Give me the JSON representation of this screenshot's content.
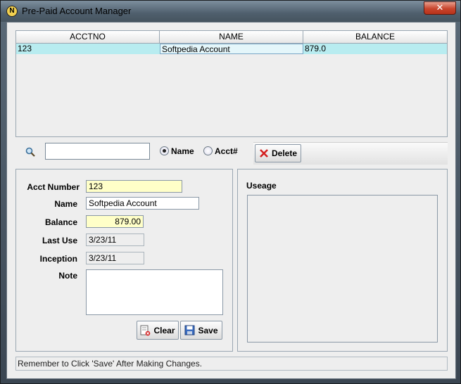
{
  "window": {
    "title": "Pre-Paid Account Manager",
    "app_icon_letter": "N",
    "close_glyph": "✕"
  },
  "table": {
    "columns": [
      "ACCTNO",
      "NAME",
      "BALANCE"
    ],
    "rows": [
      [
        "123",
        "Softpedia Account",
        "879.0"
      ]
    ]
  },
  "search": {
    "value": "",
    "radio_name_label": "Name",
    "radio_acct_label": "Acct#",
    "selected": "Name",
    "delete_label": "Delete"
  },
  "form": {
    "acct_number_label": "Acct Number",
    "acct_number_value": "123",
    "name_label": "Name",
    "name_value": "Softpedia Account",
    "balance_label": "Balance",
    "balance_value": "879.00",
    "last_use_label": "Last Use",
    "last_use_value": "3/23/11",
    "inception_label": "Inception",
    "inception_value": "3/23/11",
    "note_label": "Note",
    "note_value": "",
    "clear_label": "Clear",
    "save_label": "Save"
  },
  "usage": {
    "title": "Useage"
  },
  "status": {
    "message": "Remember to Click 'Save' After Making Changes."
  },
  "colors": {
    "row_highlight": "#b8ecf0",
    "field_yellow": "#ffffc8",
    "delete_x": "#d42020"
  },
  "icons": {
    "search": "search-icon",
    "delete": "delete-x-icon",
    "clear": "clear-icon",
    "save": "save-disk-icon",
    "close": "close-icon"
  }
}
